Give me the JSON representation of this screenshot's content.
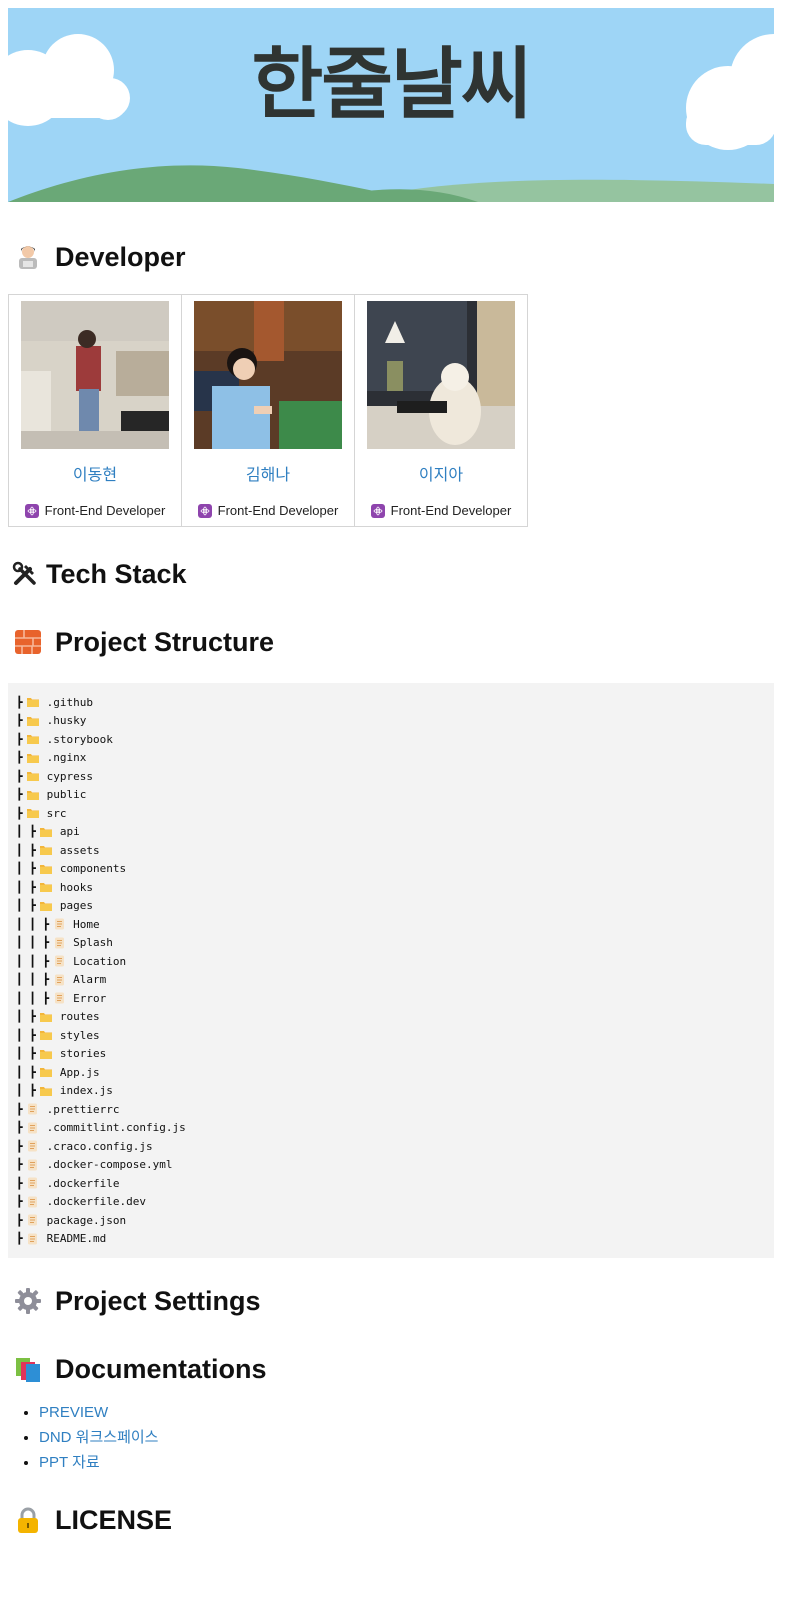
{
  "banner": {
    "logo_text": "한줄날씨"
  },
  "sections": {
    "developer": "Developer",
    "tech_stack": "Tech Stack",
    "project_structure": "Project Structure",
    "project_settings": "Project Settings",
    "documentations": "Documentations",
    "license": "LICENSE"
  },
  "developers": [
    {
      "name": "이동현",
      "role": "Front-End Developer"
    },
    {
      "name": "김해나",
      "role": "Front-End Developer"
    },
    {
      "name": "이지아",
      "role": "Front-End Developer"
    }
  ],
  "tree": [
    {
      "prefix": "┣",
      "type": "folder",
      "name": ".github"
    },
    {
      "prefix": "┣",
      "type": "folder",
      "name": ".husky"
    },
    {
      "prefix": "┣",
      "type": "folder",
      "name": ".storybook"
    },
    {
      "prefix": "┣",
      "type": "folder",
      "name": ".nginx"
    },
    {
      "prefix": "┣",
      "type": "folder",
      "name": "cypress"
    },
    {
      "prefix": "┣",
      "type": "folder",
      "name": "public"
    },
    {
      "prefix": "┣",
      "type": "folder",
      "name": "src"
    },
    {
      "prefix": "┃ ┣",
      "type": "folder",
      "name": "api"
    },
    {
      "prefix": "┃ ┣",
      "type": "folder",
      "name": "assets"
    },
    {
      "prefix": "┃ ┣",
      "type": "folder",
      "name": "components"
    },
    {
      "prefix": "┃ ┣",
      "type": "folder",
      "name": "hooks"
    },
    {
      "prefix": "┃ ┣",
      "type": "folder",
      "name": "pages"
    },
    {
      "prefix": "┃ ┃ ┣",
      "type": "file",
      "name": "Home"
    },
    {
      "prefix": "┃ ┃ ┣",
      "type": "file",
      "name": "Splash"
    },
    {
      "prefix": "┃ ┃ ┣",
      "type": "file",
      "name": "Location"
    },
    {
      "prefix": "┃ ┃ ┣",
      "type": "file",
      "name": "Alarm"
    },
    {
      "prefix": "┃ ┃ ┣",
      "type": "file",
      "name": "Error"
    },
    {
      "prefix": "┃ ┣",
      "type": "folder",
      "name": "routes"
    },
    {
      "prefix": "┃ ┣",
      "type": "folder",
      "name": "styles"
    },
    {
      "prefix": "┃ ┣",
      "type": "folder",
      "name": "stories"
    },
    {
      "prefix": "┃ ┣",
      "type": "folder",
      "name": "App.js"
    },
    {
      "prefix": "┃ ┣",
      "type": "folder",
      "name": "index.js"
    },
    {
      "prefix": "┣",
      "type": "file",
      "name": ".prettierrc"
    },
    {
      "prefix": "┣",
      "type": "file",
      "name": ".commitlint.config.js"
    },
    {
      "prefix": "┣",
      "type": "file",
      "name": ".craco.config.js"
    },
    {
      "prefix": "┣",
      "type": "file",
      "name": ".docker-compose.yml"
    },
    {
      "prefix": "┣",
      "type": "file",
      "name": ".dockerfile"
    },
    {
      "prefix": "┣",
      "type": "file",
      "name": ".dockerfile.dev"
    },
    {
      "prefix": "┣",
      "type": "file",
      "name": "package.json"
    },
    {
      "prefix": "┣",
      "type": "file",
      "name": "README.md"
    }
  ],
  "documentations": [
    {
      "label": "PREVIEW"
    },
    {
      "label": "DND 워크스페이스"
    },
    {
      "label": "PPT 자료"
    }
  ],
  "colors": {
    "link": "#2f7fc1",
    "banner_sky": "#9ed5f6",
    "code_bg": "#f3f3f3"
  }
}
